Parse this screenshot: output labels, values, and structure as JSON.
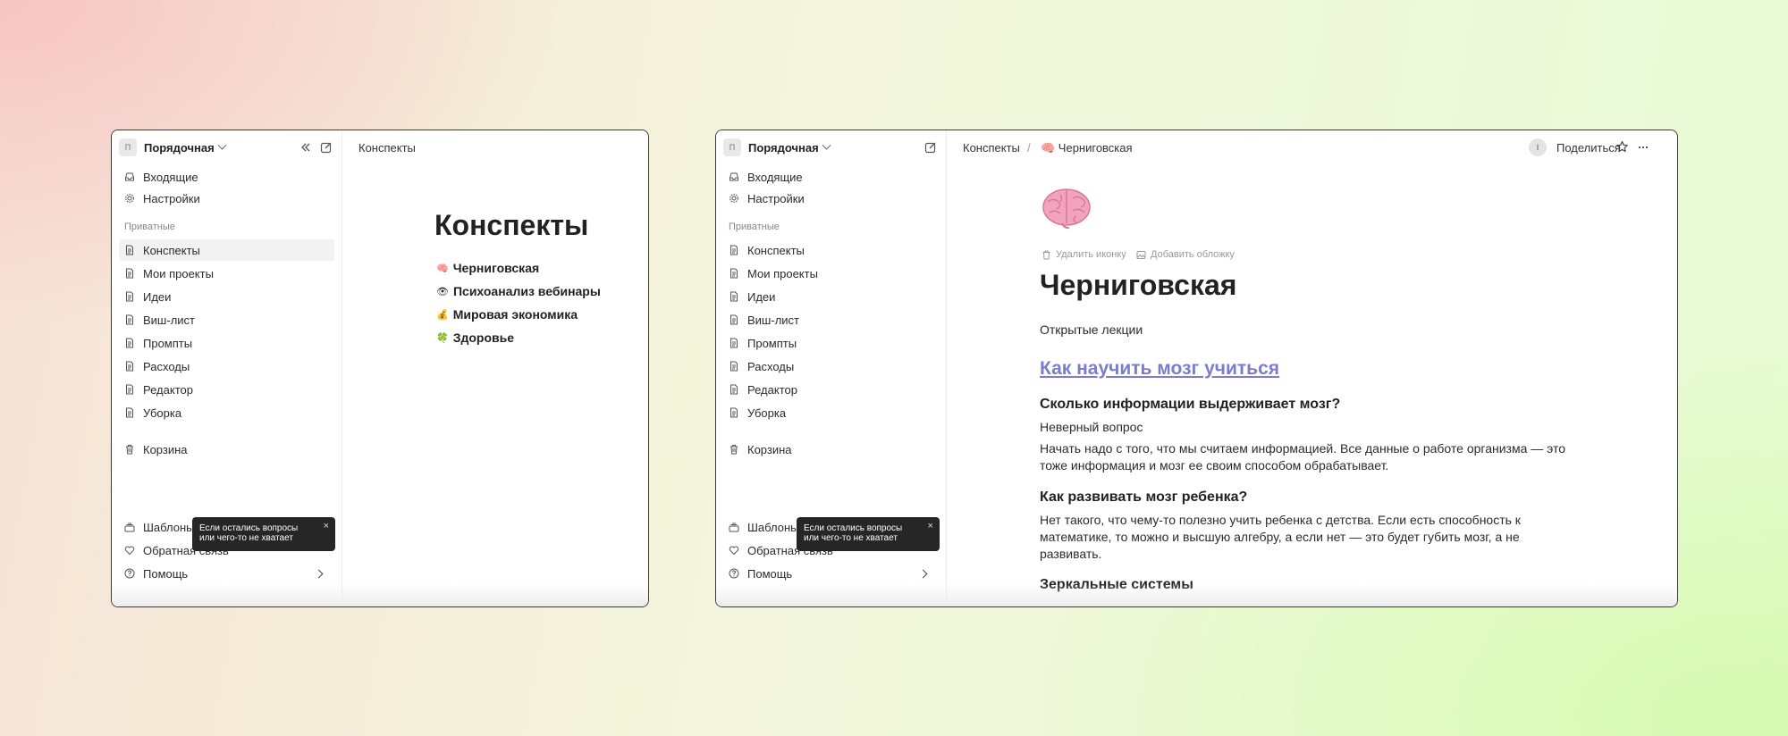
{
  "colors": {
    "link": "#7c7ccd",
    "tooltip_bg": "#262626",
    "window_border": "#3a3a3a"
  },
  "sidebar": {
    "workspace_initial": "П",
    "workspace_name": "Порядочная",
    "top_items": [
      {
        "label": "Входящие",
        "icon": "inbox-icon"
      },
      {
        "label": "Настройки",
        "icon": "gear-icon"
      }
    ],
    "section_label": "Приватные",
    "pages": [
      {
        "label": "Конспекты"
      },
      {
        "label": "Мои проекты"
      },
      {
        "label": "Идеи"
      },
      {
        "label": "Виш-лист"
      },
      {
        "label": "Промпты"
      },
      {
        "label": "Расходы"
      },
      {
        "label": "Редактор"
      },
      {
        "label": "Уборка"
      }
    ],
    "trash_label": "Корзина",
    "bottom_items": [
      {
        "label": "Шаблоны",
        "icon": "templates-icon"
      },
      {
        "label": "Обратная связь",
        "icon": "heart-icon"
      },
      {
        "label": "Помощь",
        "icon": "help-icon"
      }
    ],
    "tooltip": {
      "text": "Если остались вопросы или чего-то не хватает",
      "close": "×"
    }
  },
  "window1": {
    "breadcrumb": "Конспекты",
    "page_title": "Конспекты",
    "subpages": [
      {
        "emoji": "🧠",
        "title": "Черниговская"
      },
      {
        "emoji": "👁",
        "title": "Психоанализ вебинары"
      },
      {
        "emoji": "💰",
        "title": "Мировая экономика"
      },
      {
        "emoji": "🍀",
        "title": "Здоровье"
      }
    ]
  },
  "window2": {
    "breadcrumb_parent": "Конспекты",
    "breadcrumb_separator": "/",
    "breadcrumb_current": "🧠 Черниговская",
    "user_initial": "I",
    "share_label": "Поделиться",
    "doc": {
      "remove_icon_label": "Удалить иконку",
      "add_cover_label": "Добавить обложку",
      "title": "Черниговская",
      "subtitle": "Открытые лекции",
      "link": "Как научить мозг учиться",
      "h1": "Сколько информации выдерживает мозг?",
      "p1": "Неверный вопрос",
      "p2": "Начать надо с того, что мы считаем информацией. Все данные о работе организма — это тоже информация и мозг ее своим способом обрабатывает.",
      "h2": "Как развивать мозг ребенка?",
      "p3": "Нет такого, что чему-то полезно учить ребенка с детства. Если есть способность к математике, то можно и высшую алгебру, а если нет — это будет губить мозг, а не развивать.",
      "h3": "Зеркальные системы"
    }
  }
}
